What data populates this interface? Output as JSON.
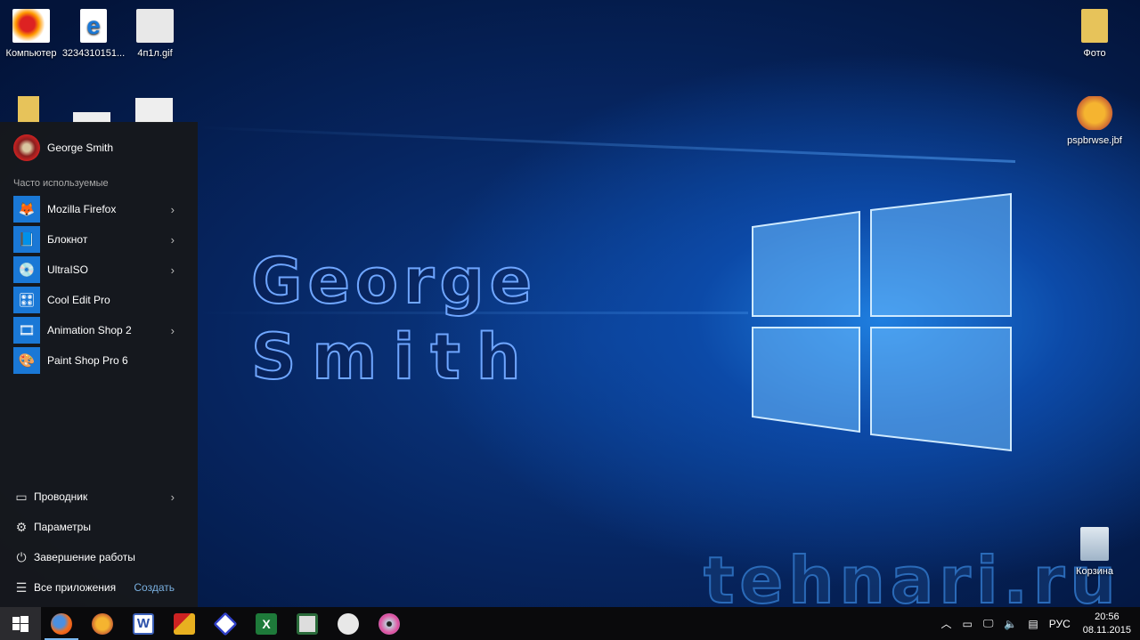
{
  "desktop": {
    "icons_left": [
      {
        "label": "Компьютер"
      },
      {
        "label": "3234310151..."
      },
      {
        "label": "4п1л.gif"
      }
    ],
    "icons_right": [
      {
        "label": "Фото"
      },
      {
        "label": "pspbrwse.jbf"
      },
      {
        "label": "Корзина"
      }
    ],
    "watermark_name": [
      "George",
      "Smith"
    ],
    "watermark_site": "tehnari.ru"
  },
  "start_menu": {
    "user": "George Smith",
    "section_label": "Часто используемые",
    "apps": [
      {
        "label": "Mozilla Firefox",
        "icon": "firefox-icon",
        "has_submenu": true
      },
      {
        "label": "Блокнот",
        "icon": "notepad-icon",
        "has_submenu": true
      },
      {
        "label": "UltraISO",
        "icon": "ultraiso-icon",
        "has_submenu": true
      },
      {
        "label": "Cool Edit Pro",
        "icon": "cool-edit-icon",
        "has_submenu": false
      },
      {
        "label": "Animation Shop 2",
        "icon": "animation-shop-icon",
        "has_submenu": true
      },
      {
        "label": "Paint Shop Pro 6",
        "icon": "paint-shop-icon",
        "has_submenu": false
      }
    ],
    "explorer": "Проводник",
    "settings": "Параметры",
    "shutdown": "Завершение работы",
    "all_apps": "Все приложения",
    "create": "Создать"
  },
  "taskbar": {
    "tray": {
      "language": "РУС",
      "time": "20:56",
      "date": "08.11.2015"
    }
  },
  "colors": {
    "accent": "#1a78d6",
    "taskbar": "#0a0a0c"
  }
}
